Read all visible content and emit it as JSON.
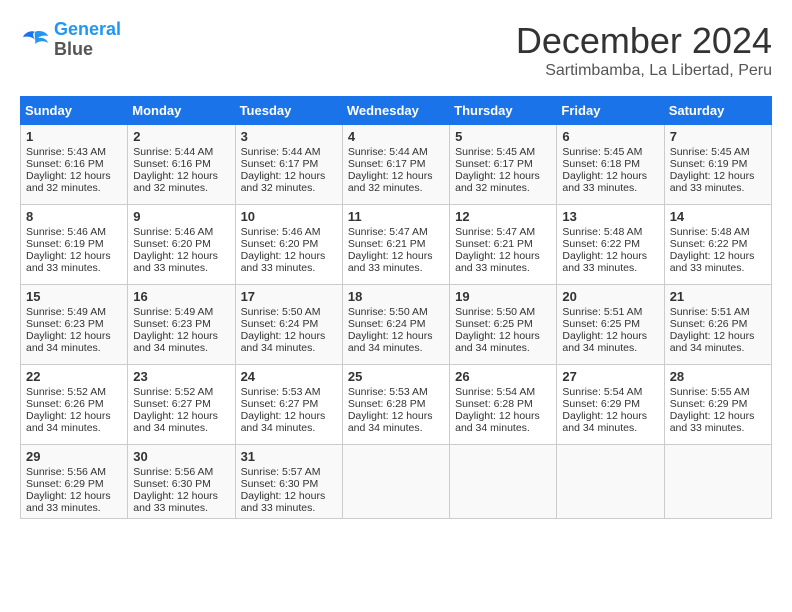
{
  "header": {
    "logo": {
      "line1": "General",
      "line2": "Blue"
    },
    "title": "December 2024",
    "subtitle": "Sartimbamba, La Libertad, Peru"
  },
  "calendar": {
    "days_of_week": [
      "Sunday",
      "Monday",
      "Tuesday",
      "Wednesday",
      "Thursday",
      "Friday",
      "Saturday"
    ],
    "weeks": [
      [
        {
          "day": "1",
          "sunrise": "5:43 AM",
          "sunset": "6:16 PM",
          "daylight": "12 hours and 32 minutes."
        },
        {
          "day": "2",
          "sunrise": "5:44 AM",
          "sunset": "6:16 PM",
          "daylight": "12 hours and 32 minutes."
        },
        {
          "day": "3",
          "sunrise": "5:44 AM",
          "sunset": "6:17 PM",
          "daylight": "12 hours and 32 minutes."
        },
        {
          "day": "4",
          "sunrise": "5:44 AM",
          "sunset": "6:17 PM",
          "daylight": "12 hours and 32 minutes."
        },
        {
          "day": "5",
          "sunrise": "5:45 AM",
          "sunset": "6:17 PM",
          "daylight": "12 hours and 32 minutes."
        },
        {
          "day": "6",
          "sunrise": "5:45 AM",
          "sunset": "6:18 PM",
          "daylight": "12 hours and 33 minutes."
        },
        {
          "day": "7",
          "sunrise": "5:45 AM",
          "sunset": "6:19 PM",
          "daylight": "12 hours and 33 minutes."
        }
      ],
      [
        {
          "day": "8",
          "sunrise": "5:46 AM",
          "sunset": "6:19 PM",
          "daylight": "12 hours and 33 minutes."
        },
        {
          "day": "9",
          "sunrise": "5:46 AM",
          "sunset": "6:20 PM",
          "daylight": "12 hours and 33 minutes."
        },
        {
          "day": "10",
          "sunrise": "5:46 AM",
          "sunset": "6:20 PM",
          "daylight": "12 hours and 33 minutes."
        },
        {
          "day": "11",
          "sunrise": "5:47 AM",
          "sunset": "6:21 PM",
          "daylight": "12 hours and 33 minutes."
        },
        {
          "day": "12",
          "sunrise": "5:47 AM",
          "sunset": "6:21 PM",
          "daylight": "12 hours and 33 minutes."
        },
        {
          "day": "13",
          "sunrise": "5:48 AM",
          "sunset": "6:22 PM",
          "daylight": "12 hours and 33 minutes."
        },
        {
          "day": "14",
          "sunrise": "5:48 AM",
          "sunset": "6:22 PM",
          "daylight": "12 hours and 33 minutes."
        }
      ],
      [
        {
          "day": "15",
          "sunrise": "5:49 AM",
          "sunset": "6:23 PM",
          "daylight": "12 hours and 34 minutes."
        },
        {
          "day": "16",
          "sunrise": "5:49 AM",
          "sunset": "6:23 PM",
          "daylight": "12 hours and 34 minutes."
        },
        {
          "day": "17",
          "sunrise": "5:50 AM",
          "sunset": "6:24 PM",
          "daylight": "12 hours and 34 minutes."
        },
        {
          "day": "18",
          "sunrise": "5:50 AM",
          "sunset": "6:24 PM",
          "daylight": "12 hours and 34 minutes."
        },
        {
          "day": "19",
          "sunrise": "5:50 AM",
          "sunset": "6:25 PM",
          "daylight": "12 hours and 34 minutes."
        },
        {
          "day": "20",
          "sunrise": "5:51 AM",
          "sunset": "6:25 PM",
          "daylight": "12 hours and 34 minutes."
        },
        {
          "day": "21",
          "sunrise": "5:51 AM",
          "sunset": "6:26 PM",
          "daylight": "12 hours and 34 minutes."
        }
      ],
      [
        {
          "day": "22",
          "sunrise": "5:52 AM",
          "sunset": "6:26 PM",
          "daylight": "12 hours and 34 minutes."
        },
        {
          "day": "23",
          "sunrise": "5:52 AM",
          "sunset": "6:27 PM",
          "daylight": "12 hours and 34 minutes."
        },
        {
          "day": "24",
          "sunrise": "5:53 AM",
          "sunset": "6:27 PM",
          "daylight": "12 hours and 34 minutes."
        },
        {
          "day": "25",
          "sunrise": "5:53 AM",
          "sunset": "6:28 PM",
          "daylight": "12 hours and 34 minutes."
        },
        {
          "day": "26",
          "sunrise": "5:54 AM",
          "sunset": "6:28 PM",
          "daylight": "12 hours and 34 minutes."
        },
        {
          "day": "27",
          "sunrise": "5:54 AM",
          "sunset": "6:29 PM",
          "daylight": "12 hours and 34 minutes."
        },
        {
          "day": "28",
          "sunrise": "5:55 AM",
          "sunset": "6:29 PM",
          "daylight": "12 hours and 33 minutes."
        }
      ],
      [
        {
          "day": "29",
          "sunrise": "5:56 AM",
          "sunset": "6:29 PM",
          "daylight": "12 hours and 33 minutes."
        },
        {
          "day": "30",
          "sunrise": "5:56 AM",
          "sunset": "6:30 PM",
          "daylight": "12 hours and 33 minutes."
        },
        {
          "day": "31",
          "sunrise": "5:57 AM",
          "sunset": "6:30 PM",
          "daylight": "12 hours and 33 minutes."
        },
        null,
        null,
        null,
        null
      ]
    ]
  }
}
